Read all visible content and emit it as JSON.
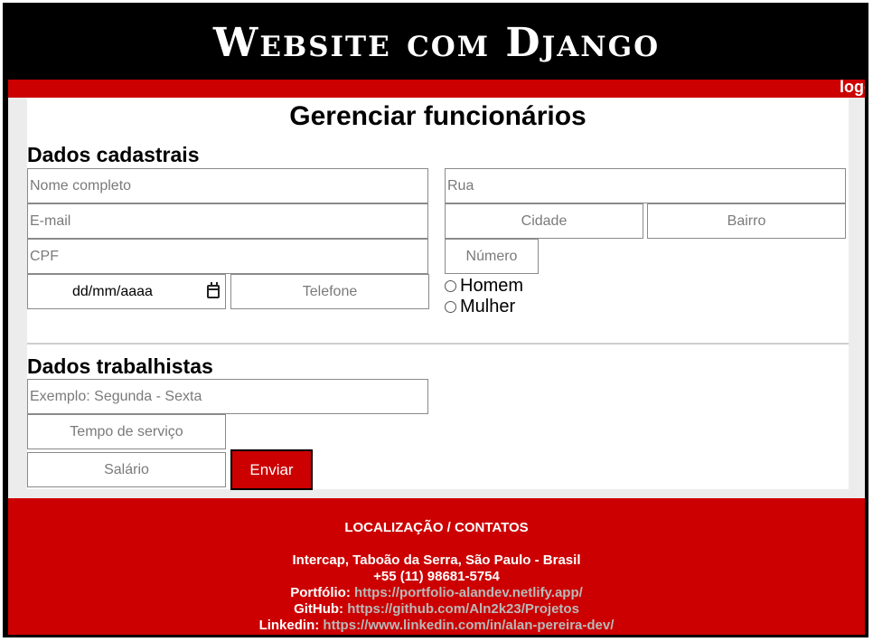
{
  "header": {
    "title": "Website com Django"
  },
  "topbar": {
    "logout_label": "logout"
  },
  "page": {
    "title": "Gerenciar funcionários"
  },
  "personal": {
    "section_title": "Dados cadastrais",
    "name_placeholder": "Nome completo",
    "email_placeholder": "E-mail",
    "cpf_placeholder": "CPF",
    "date_placeholder": "dd/mm/aaaa",
    "phone_placeholder": "Telefone",
    "street_placeholder": "Rua",
    "city_placeholder": "Cidade",
    "district_placeholder": "Bairro",
    "number_placeholder": "Número",
    "gender_options": [
      "Homem",
      "Mulher"
    ]
  },
  "work": {
    "section_title": "Dados trabalhistas",
    "schedule_placeholder": "Exemplo: Segunda - Sexta",
    "tenure_placeholder": "Tempo de serviço",
    "salary_placeholder": "Salário",
    "submit_label": "Enviar"
  },
  "footer": {
    "heading": "LOCALIZAÇÃO / CONTATOS",
    "address": "Intercap, Taboão da Serra, São Paulo - Brasil",
    "phone": "+55 (11) 98681-5754",
    "portfolio_label": "Portfólio:",
    "portfolio_url": "https://portfolio-alandev.netlify.app/",
    "github_label": "GitHub:",
    "github_url": "https://github.com/Aln2k23/Projetos",
    "linkedin_label": "Linkedin:",
    "linkedin_url": "https://www.linkedin.com/in/alan-pereira-dev/"
  },
  "colors": {
    "accent_red": "#cc0000",
    "header_black": "#000000",
    "link_gray": "#b9b9b9"
  }
}
